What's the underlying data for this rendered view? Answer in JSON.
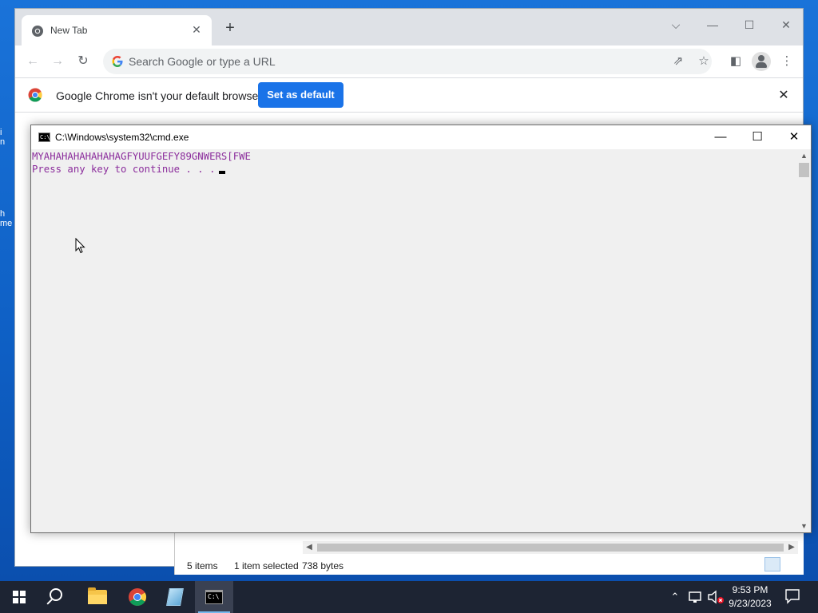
{
  "desktop": {
    "icon_fragments": [
      "i\nn",
      "h\nme"
    ]
  },
  "chrome": {
    "tab_title": "New Tab",
    "tab_close": "✕",
    "new_tab": "+",
    "omnibox_placeholder": "Search Google or type a URL",
    "infobar_text": "Google Chrome isn't your default browser",
    "set_default_label": "Set as default",
    "infobar_close": "✕",
    "window_controls": {
      "dropdown": "⌵",
      "minimize": "—",
      "maximize": "☐",
      "close": "✕"
    },
    "toolbar_icons": [
      "back-arrow-icon",
      "forward-arrow-icon",
      "reload-icon",
      "share-icon",
      "star-icon",
      "side-panel-icon",
      "profile-icon",
      "menu-dots-icon"
    ]
  },
  "explorer": {
    "status_items": "5 items",
    "status_selected": "1 item selected",
    "status_size": "738 bytes"
  },
  "cmd": {
    "title": "C:\\Windows\\system32\\cmd.exe",
    "icon_text": "C:\\",
    "lines": [
      "MYAHAHAHAHAHAHAGFYUUFGEFY89GNWERS[FWE",
      "Press any key to continue . . ."
    ],
    "text_color": "#8b2d9c",
    "window_controls": {
      "minimize": "—",
      "maximize": "☐",
      "close": "✕"
    }
  },
  "taskbar": {
    "apps": [
      "start-button",
      "search",
      "file-explorer",
      "chrome",
      "notepad",
      "cmd"
    ],
    "active_app": "cmd",
    "clock_time": "9:53 PM",
    "clock_date": "9/23/2023",
    "tray_chevron": "⌃"
  },
  "colors": {
    "chrome_blue": "#1a73e8",
    "desktop_blue": "#0e5fc4",
    "taskbar": "#1d2433"
  }
}
